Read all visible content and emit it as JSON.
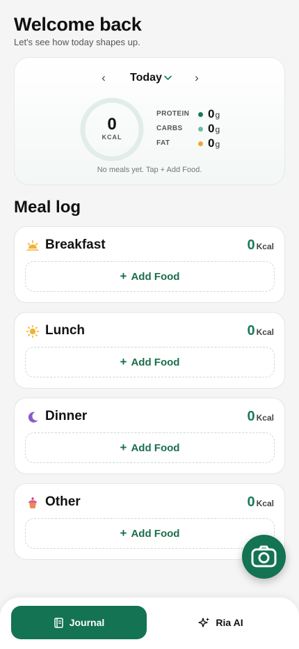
{
  "header": {
    "title": "Welcome back",
    "subtitle": "Let's see how today shapes up."
  },
  "summary": {
    "date_label": "Today",
    "calories_value": "0",
    "calories_unit": "KCAL",
    "macros": [
      {
        "label": "PROTEIN",
        "value": "0",
        "unit": "g",
        "color": "#1b7a55"
      },
      {
        "label": "CARBS",
        "value": "0",
        "unit": "g",
        "color": "#6cbfa0"
      },
      {
        "label": "FAT",
        "value": "0",
        "unit": "g",
        "color": "#f0a830"
      }
    ],
    "empty_hint": "No meals yet. Tap + Add Food."
  },
  "meal_log": {
    "title": "Meal log",
    "meals": [
      {
        "name": "Breakfast",
        "kcal": "0",
        "kcal_unit": "Kcal",
        "icon": "sunrise-icon",
        "add_label": "Add Food"
      },
      {
        "name": "Lunch",
        "kcal": "0",
        "kcal_unit": "Kcal",
        "icon": "sun-icon",
        "add_label": "Add Food"
      },
      {
        "name": "Dinner",
        "kcal": "0",
        "kcal_unit": "Kcal",
        "icon": "moon-icon",
        "add_label": "Add Food"
      },
      {
        "name": "Other",
        "kcal": "0",
        "kcal_unit": "Kcal",
        "icon": "cupcake-icon",
        "add_label": "Add Food"
      }
    ]
  },
  "fab": {
    "icon": "camera-icon"
  },
  "nav": {
    "journal_label": "Journal",
    "journal_icon": "journal-icon",
    "ria_label": "Ria AI",
    "ria_icon": "sparkle-icon"
  },
  "colors": {
    "accent": "#137352",
    "accent_text": "#1b7a55",
    "background": "#f4f5f4"
  }
}
